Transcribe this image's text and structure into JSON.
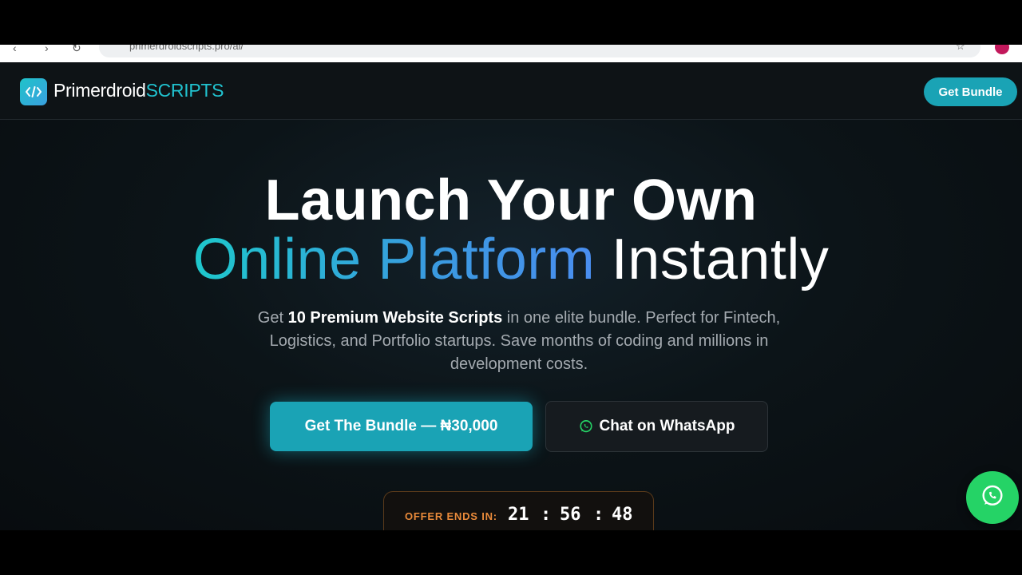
{
  "browser": {
    "url": "primerdroidscripts.pro/ai/"
  },
  "header": {
    "brand_part1": "Primerdroid",
    "brand_part2": "SCRIPTS",
    "cta_label": "Get Bundle"
  },
  "hero": {
    "line1": "Launch Your Own",
    "line2_gradient": "Online Platform",
    "line2_plain": "Instantly",
    "sub_prefix": "Get ",
    "sub_bold": "10 Premium Website Scripts",
    "sub_rest": " in one elite bundle. Perfect for Fintech, Logistics, and Portfolio startups. Save months of coding and millions in development costs."
  },
  "actions": {
    "primary_label": "Get The Bundle — ₦30,000",
    "secondary_label": "Chat on WhatsApp"
  },
  "countdown": {
    "label": "OFFER ENDS IN:",
    "hours": "21",
    "minutes": "56",
    "seconds": "48",
    "separator": ":"
  },
  "colors": {
    "accent": "#1aa3b5",
    "brand_cyan": "#21c3d0",
    "whatsapp": "#25d366",
    "countdown_label": "#e98a3a"
  },
  "icons": {
    "logo": "code-brackets-icon",
    "whatsapp": "whatsapp-icon"
  }
}
